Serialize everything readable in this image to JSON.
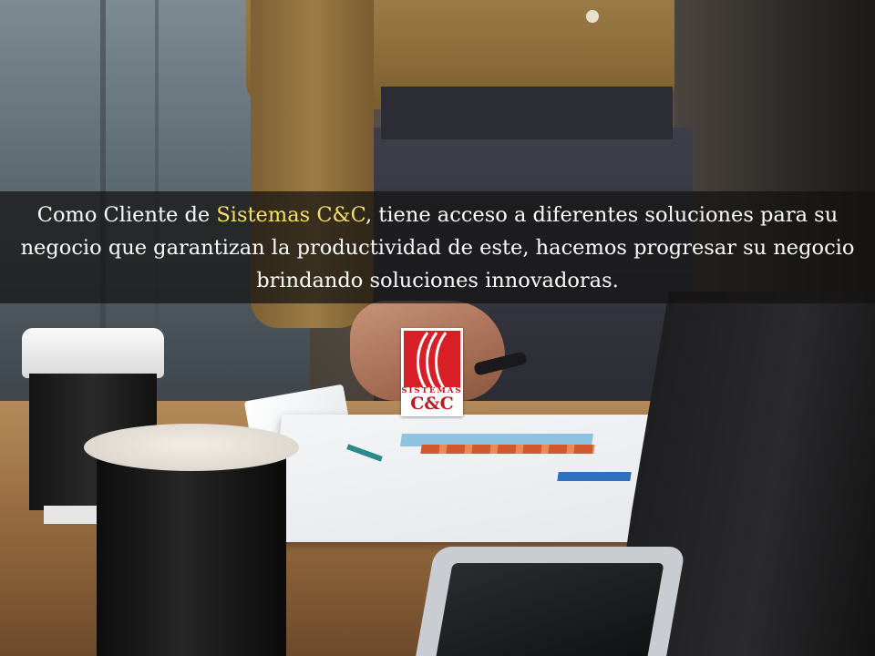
{
  "caption": {
    "part1": "Como Cliente de ",
    "brand": "Sistemas C&C",
    "part2": ", tiene acceso a diferentes soluciones para su negocio que garantizan la productividad de este, hacemos progresar su negocio brindando soluciones innovadoras."
  },
  "logo": {
    "text_top": "SISTEMAS",
    "text_bottom": "C&C",
    "icon": "three-curves-logo-icon"
  },
  "colors": {
    "brand_highlight": "#f3e06a",
    "logo_red": "#d81f26",
    "banner_bg": "rgba(20,18,16,0.72)"
  }
}
